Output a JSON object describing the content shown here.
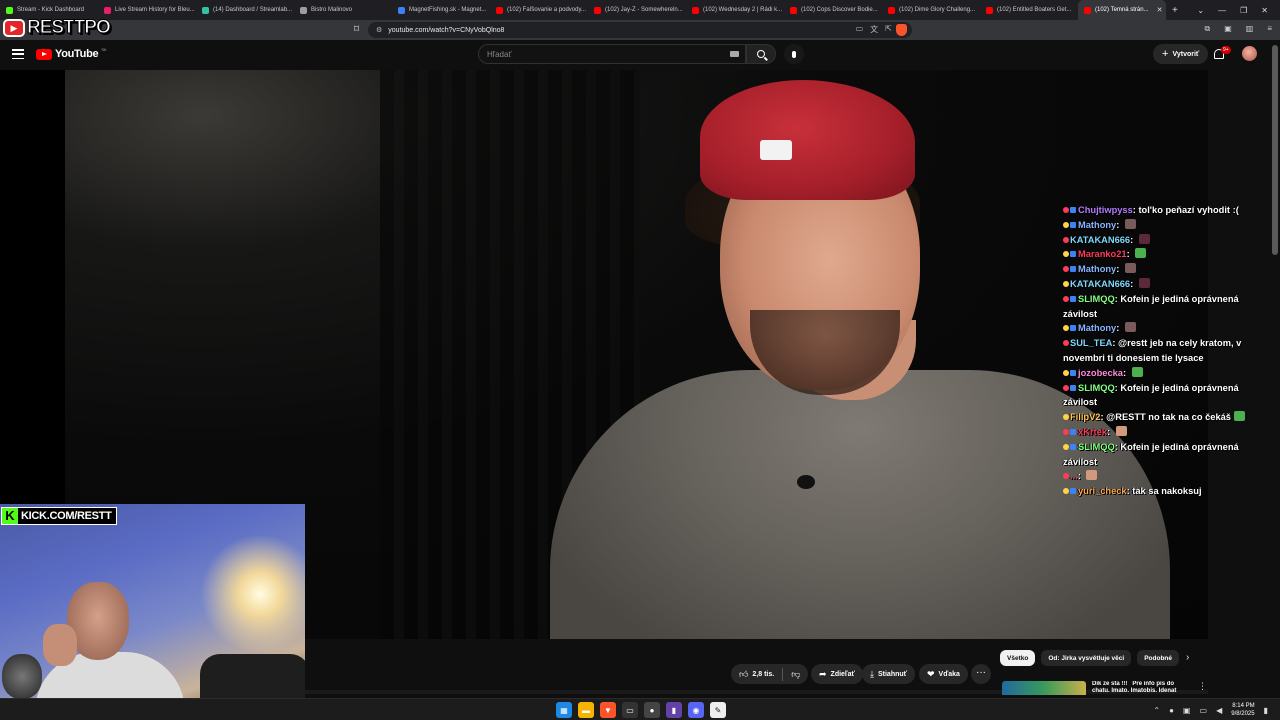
{
  "browser": {
    "tabs": [
      {
        "title": "Stream - Kick Dashboard",
        "color": "#53fc18"
      },
      {
        "title": "Live Stream History for Bleu...",
        "color": "#e91e63"
      },
      {
        "title": "(14) Dashboard / Streamlab...",
        "color": "#31c3a2"
      },
      {
        "title": "Bistro Malinovo",
        "color": "#9e9e9e"
      },
      {
        "title": "MagnetFishing.sk - Magnet...",
        "color": "#3b82f6"
      },
      {
        "title": "(102) Faľšovanie a podvody...",
        "color": "#ff0000"
      },
      {
        "title": "(102) Jay-Z - Somewhereln...",
        "color": "#ff0000"
      },
      {
        "title": "(102) Wednesday 2 | Rádi k...",
        "color": "#ff0000"
      },
      {
        "title": "(102) Cops Discover Bodie...",
        "color": "#ff0000"
      },
      {
        "title": "(102) Dime Glory Challeng...",
        "color": "#ff0000"
      },
      {
        "title": "(102) Entitled Boaters Get...",
        "color": "#ff0000"
      }
    ],
    "active_tab": {
      "title": "(102) Temná strán...",
      "color": "#ff0000"
    },
    "url": "youtube.com/watch?v=CNyVobQlno8"
  },
  "overlay": {
    "logo_text": "RESTTPO",
    "kick_label": "KICK.COM/RESTT"
  },
  "youtube": {
    "brand": "YouTube",
    "country_code": "SK",
    "search_placeholder": "Hľadať",
    "create_label": "Vytvoriť",
    "notif_count": "9+"
  },
  "chat": [
    {
      "user": "Chujtiwpyss",
      "color": "#b47cff",
      "text": "tol'ko peňazí vyhodit :(",
      "partial": true
    },
    {
      "user": "Mathony",
      "color": "#8ab4ff",
      "text": "",
      "emote": "#7a5a5a"
    },
    {
      "user": "KATAKAN666",
      "color": "#7fd7ff",
      "text": "",
      "emote": "#5a2a3a"
    },
    {
      "user": "Maranko21",
      "color": "#ff3b5c",
      "text": "",
      "emote": "#4caf50"
    },
    {
      "user": "Mathony",
      "color": "#8ab4ff",
      "text": "",
      "emote": "#7a5a5a"
    },
    {
      "user": "KATAKAN666",
      "color": "#7fd7ff",
      "text": "",
      "emote": "#5a2a3a"
    },
    {
      "user": "SLIMQQ",
      "color": "#7fff7f",
      "text": "Kofein je jediná oprávnená závilost"
    },
    {
      "user": "Mathony",
      "color": "#8ab4ff",
      "text": "",
      "emote": "#7a5a5a"
    },
    {
      "user": "SUL_TEA",
      "color": "#7fd7ff",
      "text": "@restt jeb na cely kratom, v novembri ti donesiem tie lysace"
    },
    {
      "user": "jozobecka",
      "color": "#ff8ad8",
      "text": "",
      "emote": "#4caf50"
    },
    {
      "user": "SLIMQQ",
      "color": "#7fff7f",
      "text": "Kofein je jediná oprávnená závilost"
    },
    {
      "user": "FilipV2",
      "color": "#ffc857",
      "text": "@RESTT no tak na co čekáš",
      "emote": "#4caf50"
    },
    {
      "user": "xKrtek",
      "color": "#ff3b5c",
      "text": "",
      "emote": "#d29a7c"
    },
    {
      "user": "SLIMQQ",
      "color": "#7fff7f",
      "text": "Kofein je jediná oprávnená závilost"
    },
    {
      "user": "...",
      "color": "#ff3b5c",
      "text": "",
      "emote": "#d29a7c"
    },
    {
      "user": "yuri_check",
      "color": "#ffa94d",
      "text": "tak sa nakoksuj"
    }
  ],
  "actions": {
    "like_count": "2,8 tis.",
    "share": "Zdieľať",
    "download": "Stiahnuť",
    "thanks": "Vďaka",
    "more": "···"
  },
  "sidebar": {
    "chips": [
      "Všetko",
      "Od: Jirka vysvětluje věci",
      "Podobné"
    ],
    "rec_titles": [
      "Dik ze sta !!!",
      "Pre info pis do chatu. Imato. Imatobis. Idenat"
    ]
  },
  "taskbar": {
    "time": "8:14 PM",
    "date": "9/8/2025"
  }
}
